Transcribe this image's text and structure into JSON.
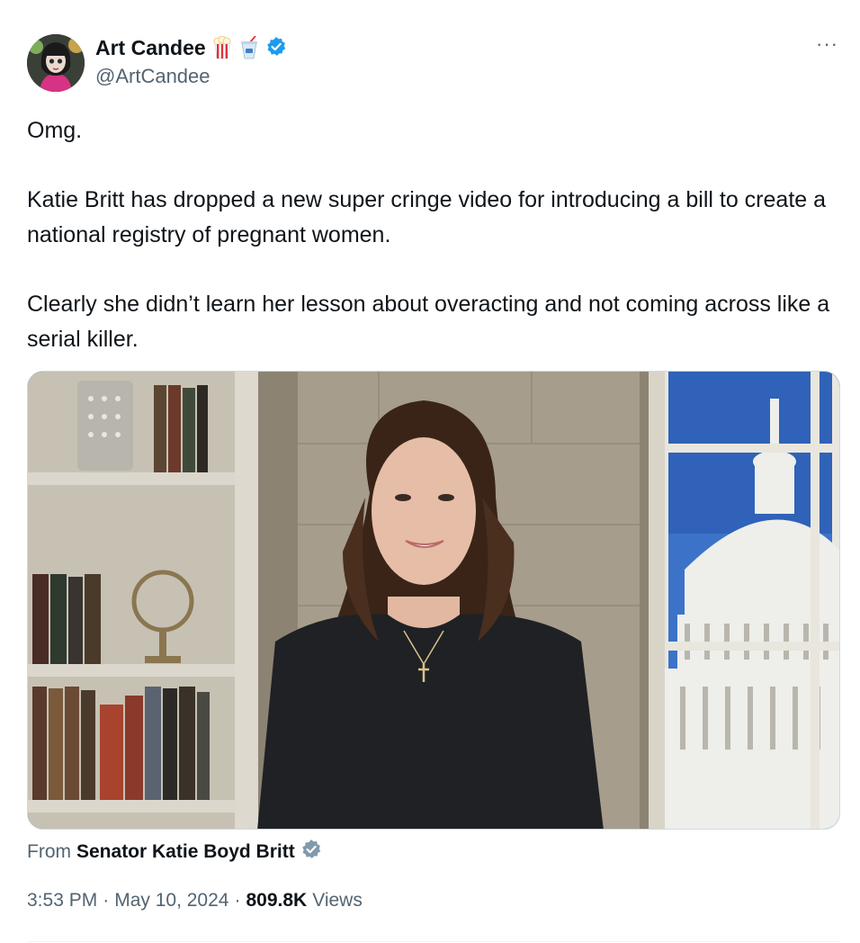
{
  "author": {
    "display_name": "Art Candee",
    "handle": "@ArtCandee",
    "badges": [
      "popcorn-emoji",
      "cup-emoji",
      "verified-badge"
    ],
    "verified_color": "#1d9bf0"
  },
  "more_label": "···",
  "tweet": {
    "paragraphs": [
      "Omg.",
      "Katie Britt has dropped a new super cringe video for introducing a bill to create a national registry of pregnant women.",
      "Clearly she didn’t learn her lesson about overacting and not coming across like a serial killer."
    ]
  },
  "media": {
    "source_prefix": "From",
    "source_name": "Senator Katie Boyd Britt",
    "source_badge": "verified-gray-badge"
  },
  "meta": {
    "time": "3:53 PM",
    "separator": "·",
    "date": "May 10, 2024",
    "views_count": "809.8K",
    "views_label": "Views"
  }
}
